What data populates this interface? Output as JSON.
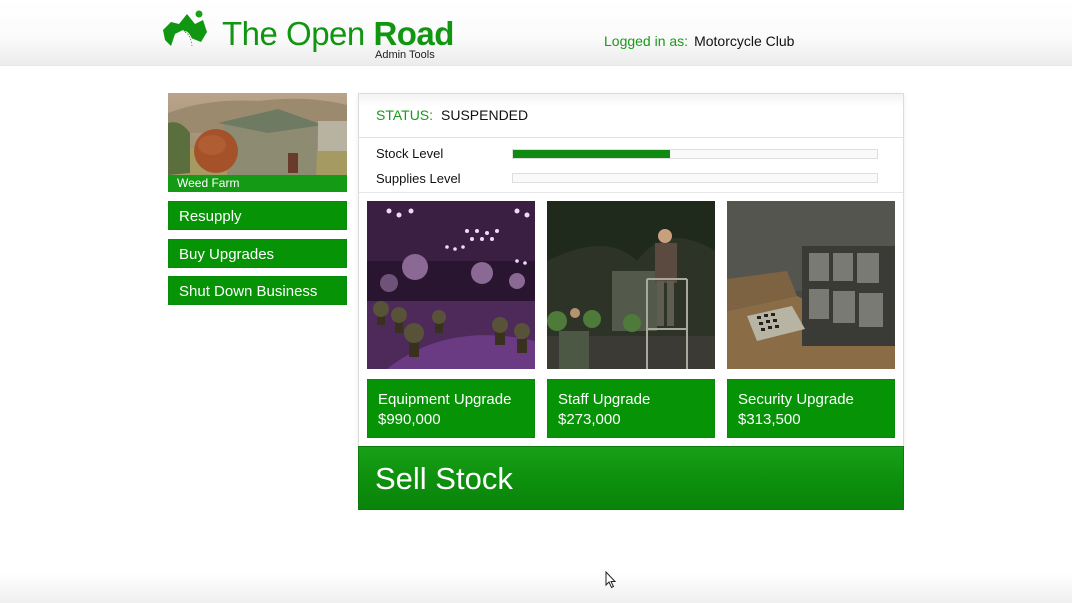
{
  "header": {
    "brand_title_light": "The Open ",
    "brand_title_bold": "Road",
    "brand_subtitle": "Admin Tools",
    "logged_in_label": "Logged in as:",
    "logged_in_user": "Motorcycle Club",
    "logo_icon": "mountain-road-logo-icon"
  },
  "sidebar": {
    "business": {
      "name": "Weed Farm",
      "image": "weed-farm-barn-photo"
    },
    "buttons": [
      {
        "label": "Resupply"
      },
      {
        "label": "Buy Upgrades"
      },
      {
        "label": "Shut Down Business"
      }
    ]
  },
  "main": {
    "status_label": "STATUS:",
    "status_value": "SUSPENDED",
    "levels": [
      {
        "label": "Stock Level",
        "value_percent": 43
      },
      {
        "label": "Supplies Level",
        "value_percent": 0
      }
    ],
    "upgrades": [
      {
        "name": "Equipment Upgrade",
        "price": "$990,000",
        "image": "grow-room-purple-lights-photo"
      },
      {
        "name": "Staff Upgrade",
        "price": "$273,000",
        "image": "staff-on-ladder-photo"
      },
      {
        "name": "Security Upgrade",
        "price": "$313,500",
        "image": "security-monitors-photo"
      }
    ],
    "sell_label": "Sell Stock"
  },
  "colors": {
    "brand_green": "#119611",
    "button_green": "#069406",
    "bar_green": "#118a11"
  }
}
